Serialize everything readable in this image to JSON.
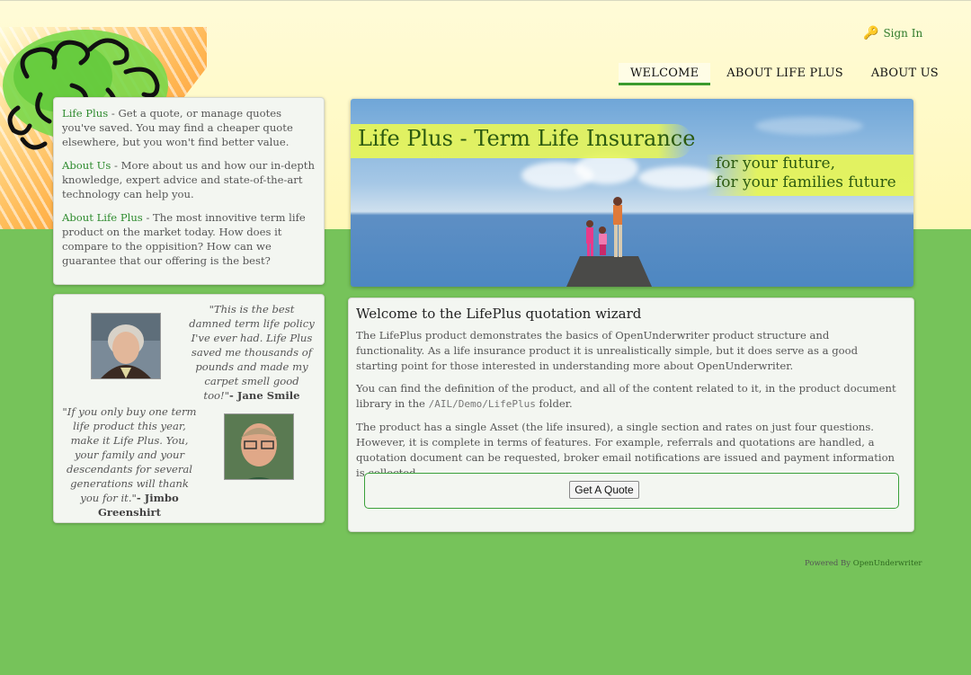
{
  "header": {
    "signin_label": "Sign In",
    "signin_icon": "key-icon"
  },
  "nav": {
    "items": [
      {
        "label": "WELCOME",
        "active": true
      },
      {
        "label": "ABOUT LIFE PLUS",
        "active": false
      },
      {
        "label": "ABOUT US",
        "active": false
      }
    ]
  },
  "links_panel": {
    "items": [
      {
        "link": "Life Plus",
        "text": " - Get a quote, or manage quotes you've saved. You may find a cheaper quote elsewhere, but you won't find better value."
      },
      {
        "link": "About Us",
        "text": " - More about us and how our in-depth knowledge, expert advice and state-of-the-art technology can help you."
      },
      {
        "link": "About Life Plus",
        "text": " - The most innovitive term life product on the market today. How does it compare to the oppisition? How can we guarantee that our offering is the best?"
      }
    ]
  },
  "testimonials": [
    {
      "quote": "\"This is the best damned term life policy I've ever had. Life Plus saved me thousands of pounds and made my carpet smell good too!\"",
      "author": "- Jane Smile"
    },
    {
      "quote": "\"If you only buy one term life product this year, make it Life Plus. You, your family and your descendants for several generations will thank you for it.\"",
      "author": "- Jimbo Greenshirt"
    }
  ],
  "banner": {
    "title": "Life Plus - Term Life Insurance",
    "subtitle_line1": "for your future,",
    "subtitle_line2": "for your families future"
  },
  "main": {
    "heading": "Welcome to the LifePlus quotation wizard",
    "para1": "The LifePlus product demonstrates the basics of OpenUnderwriter product structure and functionality. As a life insurance product it is unrealistically simple, but it does serve as a good starting point for those interested in understanding more about OpenUnderwriter.",
    "para2_before": "You can find the definition of the product, and all of the content related to it, in the product document library in the ",
    "para2_path": "/AIL/Demo/LifePlus",
    "para2_after": " folder.",
    "para3": "The product has a single Asset (the life insured), a single section and rates on just four questions. However, it is complete in terms of features. For example, referrals and quotations are handled, a quotation document can be requested, broker email notifications are issued and payment information is collected.",
    "button_label": "Get A Quote"
  },
  "footer": {
    "powered_prefix": "Powered By ",
    "powered_link": "OpenUnderwriter"
  },
  "colors": {
    "background_green": "#76c35a",
    "top_cream": "#fff8b8",
    "link_green": "#2e8b2e",
    "nav_active_underline": "#3a9a2e"
  }
}
